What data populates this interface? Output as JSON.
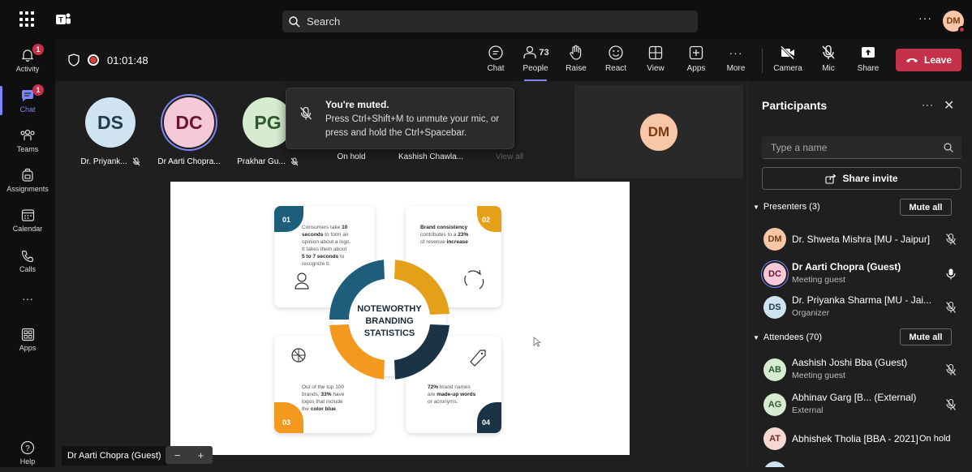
{
  "search": {
    "label": "Search"
  },
  "top": {
    "more": "···",
    "me_initials": "DM"
  },
  "rail": {
    "items": [
      {
        "label": "Activity",
        "badge": "1"
      },
      {
        "label": "Chat",
        "badge": "1"
      },
      {
        "label": "Teams"
      },
      {
        "label": "Assignments"
      },
      {
        "label": "Calendar"
      },
      {
        "label": "Calls"
      },
      {
        "label": "···"
      },
      {
        "label": "Apps"
      },
      {
        "label": "Help"
      }
    ]
  },
  "meeting": {
    "timer": "01:01:48",
    "people_count": "73",
    "tools": [
      "Chat",
      "People",
      "Raise",
      "React",
      "View",
      "Apps",
      "More",
      "Camera",
      "Mic",
      "Share"
    ],
    "leave_label": "Leave"
  },
  "stage": {
    "tiles": [
      {
        "initials": "DS",
        "name": "Dr. Priyank...",
        "bg": "#cfe4f0",
        "fg": "#1f3b4d"
      },
      {
        "initials": "DC",
        "name": "Dr Aarti Chopra...",
        "bg": "#f6c9d8",
        "fg": "#6b1530"
      },
      {
        "initials": "PG",
        "name": "Prakhar Gu...",
        "bg": "#d6ebd0",
        "fg": "#2c5a2c"
      },
      {
        "initials": "",
        "name": "On hold"
      },
      {
        "initials": "",
        "name": "Kashish Chawla..."
      },
      {
        "initials": "",
        "name": "View all"
      }
    ],
    "toast_title": "You're muted.",
    "toast_body": "Press Ctrl+Shift+M to unmute your mic, or press and hold the Ctrl+Spacebar.",
    "dm_initials": "DM",
    "presenter_label": "Dr Aarti Chopra (Guest)",
    "zoom_minus": "−",
    "zoom_plus": "+"
  },
  "slide": {
    "center": [
      "NOTEWORTHY",
      "BRANDING",
      "STATISTICS"
    ],
    "card1_num": "01",
    "card1_text_a": "Consumers take ",
    "card1_bold_a": "10 seconds",
    "card1_text_b": " to form an opinion about a logo. It takes them about ",
    "card1_bold_b": "5 to 7 seconds",
    "card1_text_c": " to recognize it.",
    "card2_num": "02",
    "card2_bold_a": "Brand consistency",
    "card2_text_a": " contributes to a ",
    "card2_bold_b": "23%",
    "card2_text_b": " of revenue ",
    "card2_bold_c": "increase",
    "card3_num": "03",
    "card3_text_a": "Out of the top 100 brands, ",
    "card3_bold_a": "33%",
    "card3_text_b": " have logos that include the ",
    "card3_bold_b": "color blue",
    "card3_text_c": ".",
    "card4_num": "04",
    "card4_bold_a": "72%",
    "card4_text_a": " brand names are ",
    "card4_bold_b": "made-up words",
    "card4_text_b": " or acronyms."
  },
  "panel": {
    "title": "Participants",
    "more": "···",
    "close": "✕",
    "search_placeholder": "Type a name",
    "share_invite": "Share invite",
    "presenters_label": "Presenters (3)",
    "attendees_label": "Attendees (70)",
    "mute_all": "Mute all",
    "presenters": [
      {
        "initials": "DM",
        "name": "Dr. Shweta Mishra [MU - Jaipur]",
        "sub": "",
        "bg": "#f7c7a8",
        "fg": "#7a3b12",
        "mic": "muted"
      },
      {
        "initials": "DC",
        "name": "Dr Aarti Chopra (Guest)",
        "sub": "Meeting guest",
        "bg": "#f6c9d8",
        "fg": "#6b1530",
        "mic": "on"
      },
      {
        "initials": "DS",
        "name": "Dr. Priyanka Sharma [MU - Jai...",
        "sub": "Organizer",
        "bg": "#cfe4f0",
        "fg": "#1f3b4d",
        "mic": "muted"
      }
    ],
    "attendees": [
      {
        "initials": "AB",
        "name": "Aashish Joshi Bba (Guest)",
        "sub": "Meeting guest",
        "bg": "#d6ebd0",
        "fg": "#2c5a2c",
        "mic": "muted"
      },
      {
        "initials": "AG",
        "name": "Abhinav Garg [B... (External)",
        "sub": "External",
        "bg": "#d6ebd0",
        "fg": "#2c5a2c",
        "mic": "muted"
      },
      {
        "initials": "AT",
        "name": "Abhishek Tholia [BBA - 2021]",
        "sub": "",
        "bg": "#f6d8d0",
        "fg": "#6b2e1f",
        "status": "On hold"
      }
    ]
  }
}
